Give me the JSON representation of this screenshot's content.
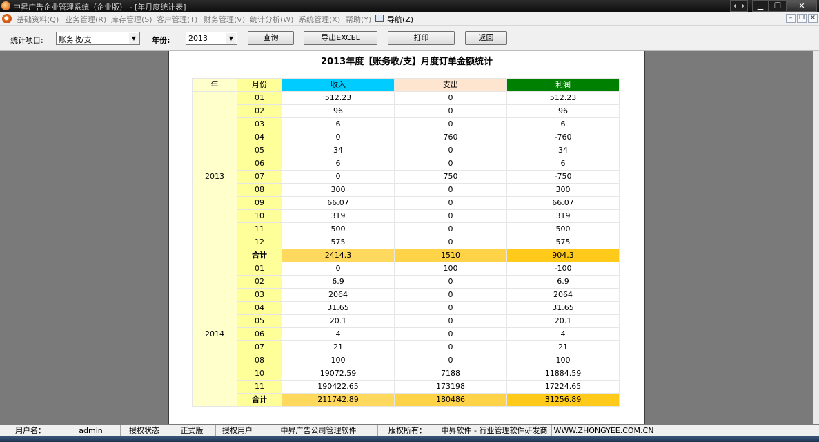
{
  "window": {
    "title": "中昇广告企业管理系统（企业版） - [年月度统计表]"
  },
  "menu": {
    "items": [
      "基础资料(Q)",
      "业务管理(R)",
      "库存管理(S)",
      "客户管理(T)",
      "财务管理(V)",
      "统计分析(W)",
      "系统管理(X)",
      "帮助(Y)"
    ],
    "nav_label": "导航(Z)"
  },
  "toolbar": {
    "stat_item_label": "统计项目:",
    "stat_item_value": "账务收/支",
    "year_label": "年份:",
    "year_value": "2013",
    "query_button": "查询",
    "export_button": "导出EXCEL",
    "print_button": "打印",
    "back_button": "返回"
  },
  "report": {
    "title": "2013年度【账务收/支】月度订单金额统计",
    "headers": {
      "year": "年",
      "month": "月份",
      "income": "收入",
      "expense": "支出",
      "profit": "利润"
    },
    "colors": {
      "income_header": "#00ccff",
      "expense_header": "#fde5cf",
      "profit_header": "#008000",
      "total_row": "#ffcc33"
    },
    "groups": [
      {
        "year": "2013",
        "rows": [
          {
            "month": "01",
            "income": "512.23",
            "expense": "0",
            "profit": "512.23"
          },
          {
            "month": "02",
            "income": "96",
            "expense": "0",
            "profit": "96"
          },
          {
            "month": "03",
            "income": "6",
            "expense": "0",
            "profit": "6"
          },
          {
            "month": "04",
            "income": "0",
            "expense": "760",
            "profit": "-760"
          },
          {
            "month": "05",
            "income": "34",
            "expense": "0",
            "profit": "34"
          },
          {
            "month": "06",
            "income": "6",
            "expense": "0",
            "profit": "6"
          },
          {
            "month": "07",
            "income": "0",
            "expense": "750",
            "profit": "-750"
          },
          {
            "month": "08",
            "income": "300",
            "expense": "0",
            "profit": "300"
          },
          {
            "month": "09",
            "income": "66.07",
            "expense": "0",
            "profit": "66.07"
          },
          {
            "month": "10",
            "income": "319",
            "expense": "0",
            "profit": "319"
          },
          {
            "month": "11",
            "income": "500",
            "expense": "0",
            "profit": "500"
          },
          {
            "month": "12",
            "income": "575",
            "expense": "0",
            "profit": "575"
          }
        ],
        "total": {
          "label": "合计",
          "income": "2414.3",
          "expense": "1510",
          "profit": "904.3"
        }
      },
      {
        "year": "2014",
        "rows": [
          {
            "month": "01",
            "income": "0",
            "expense": "100",
            "profit": "-100"
          },
          {
            "month": "02",
            "income": "6.9",
            "expense": "0",
            "profit": "6.9"
          },
          {
            "month": "03",
            "income": "2064",
            "expense": "0",
            "profit": "2064"
          },
          {
            "month": "04",
            "income": "31.65",
            "expense": "0",
            "profit": "31.65"
          },
          {
            "month": "05",
            "income": "20.1",
            "expense": "0",
            "profit": "20.1"
          },
          {
            "month": "06",
            "income": "4",
            "expense": "0",
            "profit": "4"
          },
          {
            "month": "07",
            "income": "21",
            "expense": "0",
            "profit": "21"
          },
          {
            "month": "08",
            "income": "100",
            "expense": "0",
            "profit": "100"
          },
          {
            "month": "10",
            "income": "19072.59",
            "expense": "7188",
            "profit": "11884.59"
          },
          {
            "month": "11",
            "income": "190422.65",
            "expense": "173198",
            "profit": "17224.65"
          }
        ],
        "total": {
          "label": "合计",
          "income": "211742.89",
          "expense": "180486",
          "profit": "31256.89"
        }
      }
    ]
  },
  "status": {
    "user_label": "用户名：",
    "user_value": "admin",
    "auth_status_label": "授权状态",
    "auth_status_value": "正式版",
    "auth_user_label": "授权用户",
    "auth_user_value": "中昇广告公司管理软件",
    "copyright_label": "版权所有：",
    "copyright_value": "中昇软件 - 行业管理软件研发商",
    "website": "WWW.ZHONGYEE.COM.CN"
  }
}
